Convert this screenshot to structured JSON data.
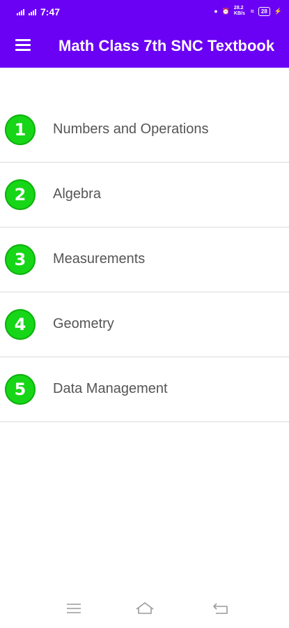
{
  "status_bar": {
    "time": "7:47",
    "speed": "28.2 KB/s",
    "battery": "28"
  },
  "app_bar": {
    "title": "Math Class 7th SNC Textbook",
    "menu_icon": "hamburger-menu-icon"
  },
  "chapters": [
    {
      "number": "1",
      "label": "Numbers and Operations"
    },
    {
      "number": "2",
      "label": "Algebra"
    },
    {
      "number": "3",
      "label": "Measurements"
    },
    {
      "number": "4",
      "label": "Geometry"
    },
    {
      "number": "5",
      "label": "Data Management"
    }
  ],
  "colors": {
    "primary": "#6a00f4",
    "badge": "#17d617",
    "text": "#555555",
    "divider": "#dcdcdc"
  },
  "nav_bar": {
    "icons": [
      "recent-apps-icon",
      "home-icon",
      "back-icon"
    ]
  }
}
